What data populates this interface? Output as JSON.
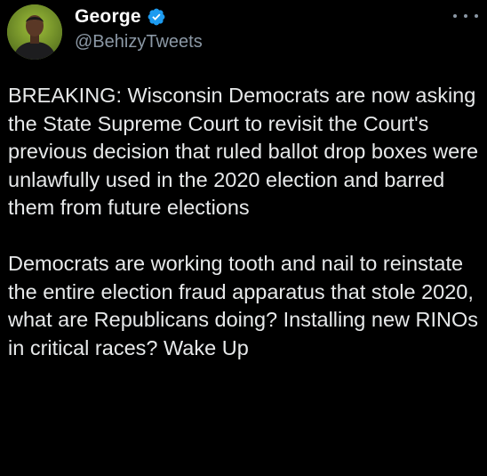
{
  "tweet": {
    "author": {
      "display_name": "George",
      "handle": "@BehizyTweets",
      "verified": true,
      "avatar_icon": "profile-photo",
      "verified_icon": "verified-badge-icon",
      "verified_color": "#1d9bf0"
    },
    "more_icon": "more-options-icon",
    "paragraphs": [
      "BREAKING: Wisconsin Democrats are now asking the State Supreme Court to revisit the Court's previous decision that ruled ballot drop boxes were unlawfully used in the 2020 election and barred them from future elections",
      "Democrats are working tooth and nail to reinstate the entire election fraud apparatus that stole 2020, what are Republicans doing? Installing new RINOs in critical races? Wake Up"
    ]
  },
  "colors": {
    "background": "#000000",
    "primary_text": "#e7e9ea",
    "secondary_text": "#8b98a5",
    "accent": "#1d9bf0"
  }
}
